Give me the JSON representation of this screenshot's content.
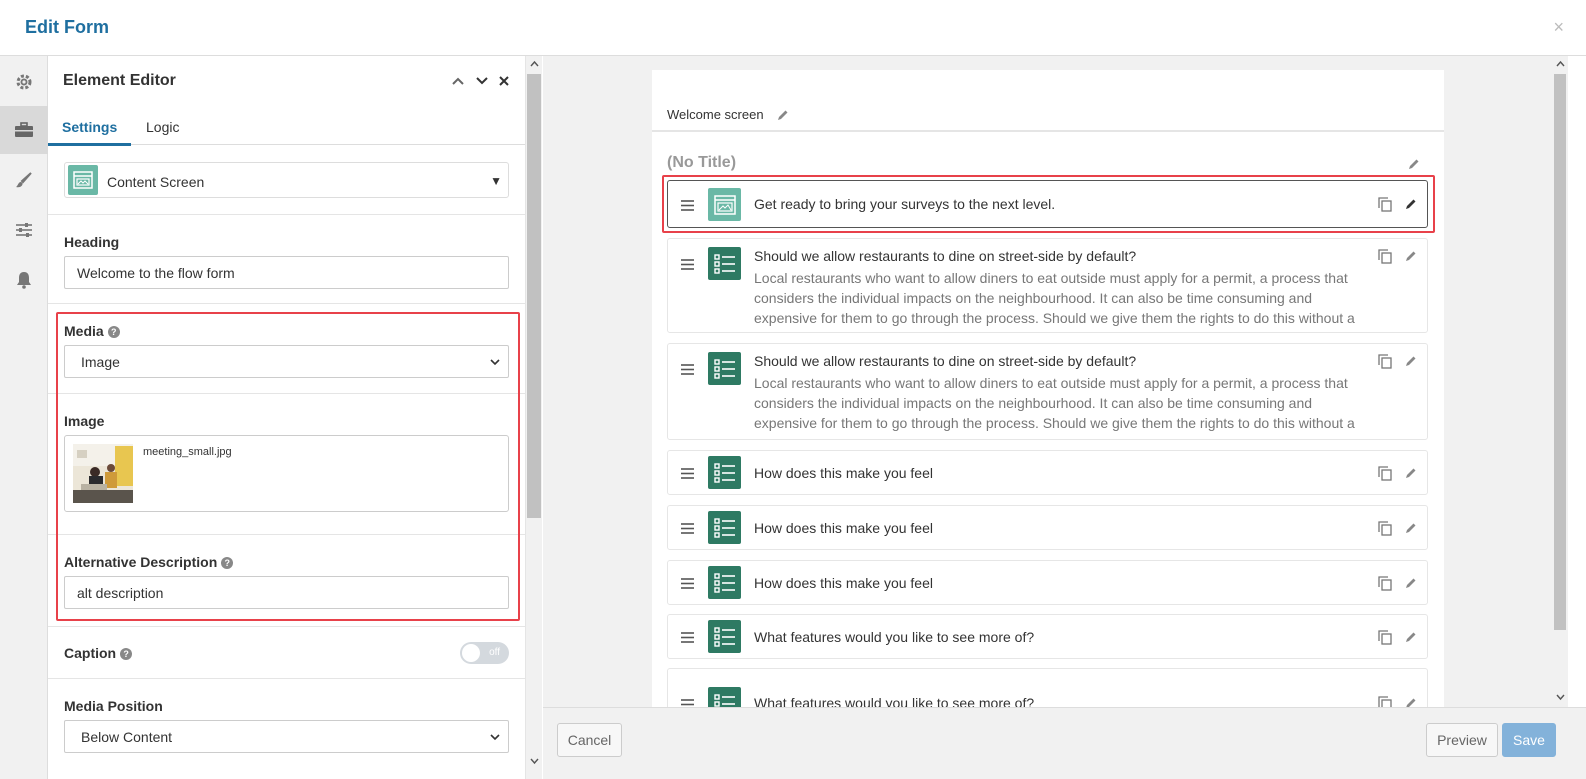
{
  "header": {
    "title": "Edit Form"
  },
  "element_editor": {
    "title": "Element Editor",
    "tabs": [
      {
        "label": "Settings"
      },
      {
        "label": "Logic"
      }
    ],
    "element_type": "Content Screen",
    "heading": {
      "label": "Heading",
      "value": "Welcome to the flow form"
    },
    "media": {
      "label": "Media",
      "value": "Image"
    },
    "image": {
      "label": "Image",
      "filename": "meeting_small.jpg"
    },
    "alt": {
      "label": "Alternative Description",
      "value": "alt description"
    },
    "caption": {
      "label": "Caption",
      "toggle": "off"
    },
    "media_position": {
      "label": "Media Position",
      "value": "Below Content"
    }
  },
  "canvas": {
    "welcome_label": "Welcome screen",
    "section_title": "(No Title)",
    "items": [
      {
        "title": "Get ready to bring your surveys to the next level.",
        "type": "content",
        "selected": true
      },
      {
        "title": "Should we allow restaurants to dine on street-side by default?",
        "desc": "Local restaurants who want to allow diners to eat outside must apply for a permit, a process that considers the individual impacts on the neighbourhood. It can also be time consuming and expensive for them to go through the process. Should we give them the rights to do this without a permit",
        "type": "question"
      },
      {
        "title": "Should we allow restaurants to dine on street-side by default?",
        "desc": "Local restaurants who want to allow diners to eat outside must apply for a permit, a process that considers the individual impacts on the neighbourhood. It can also be time consuming and expensive for them to go through the process. Should we give them the rights to do this without a permit",
        "type": "question"
      },
      {
        "title": "How does this make you feel",
        "type": "question"
      },
      {
        "title": "How does this make you feel",
        "type": "question"
      },
      {
        "title": "How does this make you feel",
        "type": "question"
      },
      {
        "title": "What features would you like to see more of?",
        "type": "question"
      },
      {
        "title": "What features would you like to see more of?",
        "type": "question"
      }
    ]
  },
  "footer": {
    "cancel": "Cancel",
    "preview": "Preview",
    "save": "Save"
  },
  "colors": {
    "accent": "#1f6fa0",
    "highlight": "#e8414a",
    "question_icon": "#2e7a63",
    "content_icon": "#6ab8a6",
    "save": "#83b2da"
  },
  "icons": [
    "gear-icon",
    "toolbox-icon",
    "brush-icon",
    "sliders-icon",
    "bell-icon",
    "drag-handle-icon",
    "copy-icon",
    "pencil-icon",
    "chevron-up-icon",
    "chevron-down-icon",
    "close-icon",
    "help-icon"
  ]
}
